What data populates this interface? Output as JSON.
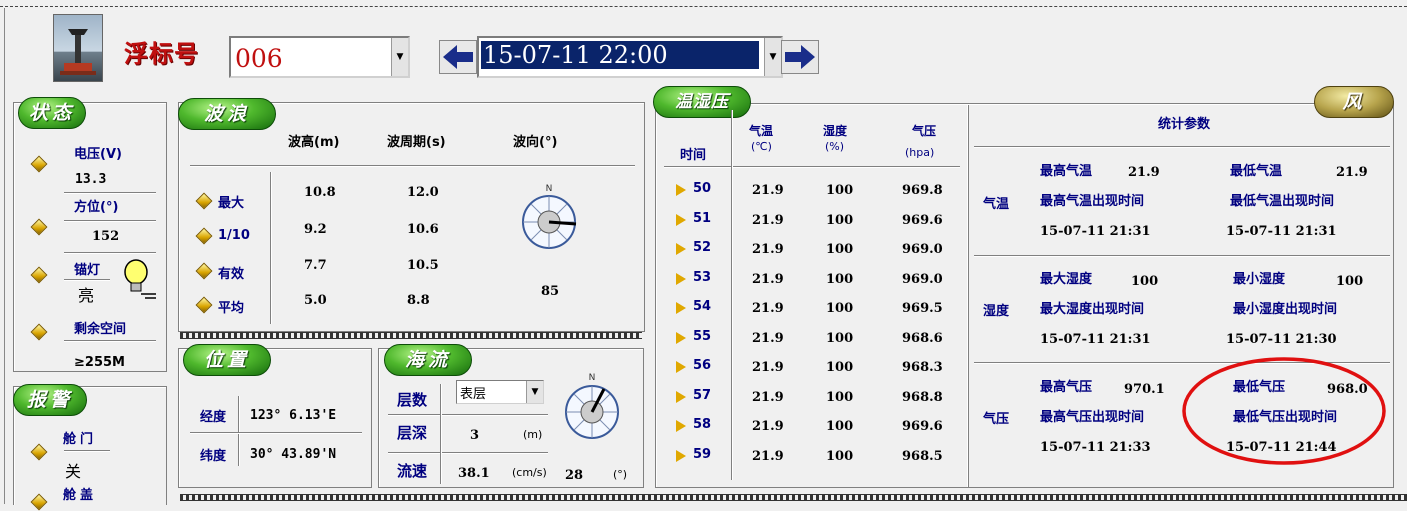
{
  "header": {
    "buoy_label": "浮标号",
    "buoy_value": "006",
    "datetime_value": "15-07-11 22:00"
  },
  "status": {
    "title": "状态",
    "voltage_label": "电压(V)",
    "voltage_value": "13.3",
    "bearing_label": "方位(°)",
    "bearing_value": "152",
    "anchor_light_label": "锚灯",
    "anchor_light_value": "亮",
    "space_label": "剩余空间",
    "space_value": "≥255M"
  },
  "alarm": {
    "title": "报警",
    "hatch_door_label": "舱门",
    "hatch_door_value": "关",
    "hatch_cover_label": "舱盖"
  },
  "wave": {
    "title": "波浪",
    "col_height": "波高(m)",
    "col_period": "波周期(s)",
    "col_direction": "波向(°)",
    "rows": [
      {
        "label": "最大",
        "height": "10.8",
        "period": "12.0"
      },
      {
        "label": "1/10",
        "height": "9.2",
        "period": "10.6"
      },
      {
        "label": "有效",
        "height": "7.7",
        "period": "10.5"
      },
      {
        "label": "平均",
        "height": "5.0",
        "period": "8.8"
      }
    ],
    "compass_n": "N",
    "direction_value": "85"
  },
  "position": {
    "title": "位置",
    "lon_label": "经度",
    "lon_value": "123° 6.13'E",
    "lat_label": "纬度",
    "lat_value": "30° 43.89'N"
  },
  "current": {
    "title": "海流",
    "layer_label": "层数",
    "layer_value": "表层",
    "depth_label": "层深",
    "depth_value": "3",
    "depth_unit": "(m)",
    "speed_label": "流速",
    "speed_value": "38.1",
    "speed_unit": "(cm/s)",
    "dir_value": "28",
    "dir_unit": "(°)",
    "compass_n": "N"
  },
  "thp": {
    "title": "温湿压",
    "col_time": "时间",
    "col_temp": "气温",
    "col_temp_unit": "(℃)",
    "col_hum": "湿度",
    "col_hum_unit": "(%)",
    "col_press": "气压",
    "col_press_unit": "(hpa)",
    "rows": [
      {
        "time": "50",
        "temp": "21.9",
        "hum": "100",
        "press": "969.8"
      },
      {
        "time": "51",
        "temp": "21.9",
        "hum": "100",
        "press": "969.6"
      },
      {
        "time": "52",
        "temp": "21.9",
        "hum": "100",
        "press": "969.0"
      },
      {
        "time": "53",
        "temp": "21.9",
        "hum": "100",
        "press": "969.0"
      },
      {
        "time": "54",
        "temp": "21.9",
        "hum": "100",
        "press": "969.5"
      },
      {
        "time": "55",
        "temp": "21.9",
        "hum": "100",
        "press": "968.6"
      },
      {
        "time": "56",
        "temp": "21.9",
        "hum": "100",
        "press": "968.3"
      },
      {
        "time": "57",
        "temp": "21.9",
        "hum": "100",
        "press": "968.8"
      },
      {
        "time": "58",
        "temp": "21.9",
        "hum": "100",
        "press": "969.6"
      },
      {
        "time": "59",
        "temp": "21.9",
        "hum": "100",
        "press": "968.5"
      }
    ]
  },
  "stats": {
    "title": "统计参数",
    "wind_title": "风",
    "temp": {
      "label": "气温",
      "max_label": "最高气温",
      "max_value": "21.9",
      "min_label": "最低气温",
      "min_value": "21.9",
      "max_time_label": "最高气温出现时间",
      "max_time": "15-07-11 21:31",
      "min_time_label": "最低气温出现时间",
      "min_time": "15-07-11 21:31"
    },
    "hum": {
      "label": "湿度",
      "max_label": "最大湿度",
      "max_value": "100",
      "min_label": "最小湿度",
      "min_value": "100",
      "max_time_label": "最大湿度出现时间",
      "max_time": "15-07-11 21:31",
      "min_time_label": "最小湿度出现时间",
      "min_time": "15-07-11 21:30"
    },
    "press": {
      "label": "气压",
      "max_label": "最高气压",
      "max_value": "970.1",
      "min_label": "最低气压",
      "min_value": "968.0",
      "max_time_label": "最高气压出现时间",
      "max_time": "15-07-11 21:33",
      "min_time_label": "最低气压出现时间",
      "min_time": "15-07-11 21:44"
    }
  },
  "colors": {
    "highlight_circle": "#e01010",
    "datetime_bg": "#0a246a",
    "pill_green": "#4fb82d",
    "pill_gold": "#b7a44c"
  }
}
